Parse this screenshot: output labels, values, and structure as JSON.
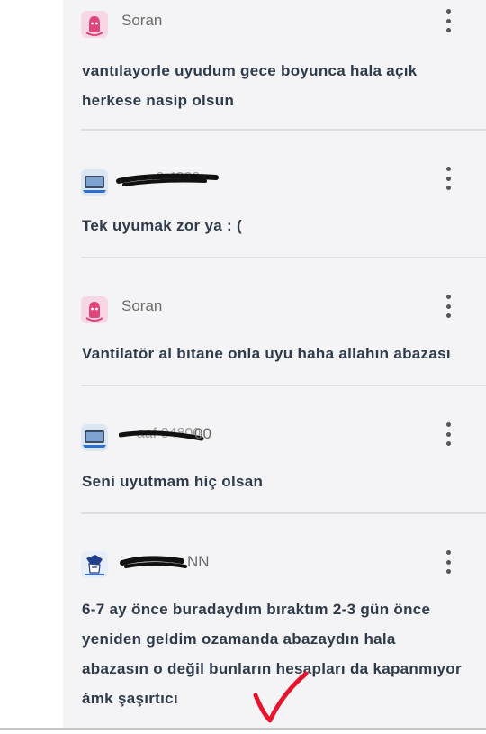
{
  "comments": [
    {
      "username": "Soran",
      "avatar_icon": "pink-ghost-avatar-icon",
      "text_lines": [
        "vantılayorle uyudum gece boyunca hala açık",
        "herkese nasip olsun"
      ]
    },
    {
      "username": "",
      "avatar_icon": "laptop-avatar-icon",
      "redacted": true,
      "text_lines": [
        "Tek uyumak zor ya : ("
      ]
    },
    {
      "username": "Soran",
      "avatar_icon": "pink-ghost-avatar-icon",
      "text_lines": [
        "Vantilatör al bıtane onla uyu haha allahın abazası"
      ]
    },
    {
      "username": "",
      "username_visible_fragment": "00",
      "avatar_icon": "laptop-avatar-icon",
      "redacted": true,
      "text_lines": [
        "Seni uyutmam hiç olsan"
      ]
    },
    {
      "username": "",
      "username_visible_fragment": "NN",
      "avatar_icon": "anime-avatar-icon",
      "redacted": true,
      "text_lines": [
        "6-7 ay önce buradaydım bıraktım 2-3 gün önce",
        "yeniden geldim ozamanda abazaydın hala",
        "abazasın o değil bunların hesapları da kapanmıyor",
        "ámk şaşırtıcı"
      ]
    }
  ],
  "colors": {
    "panel_bg": "#f4f4f6",
    "text": "#2f3a4a",
    "username": "#6b6b6b",
    "accent_pink": "#e0457b",
    "checkmark": "#e8132e"
  }
}
